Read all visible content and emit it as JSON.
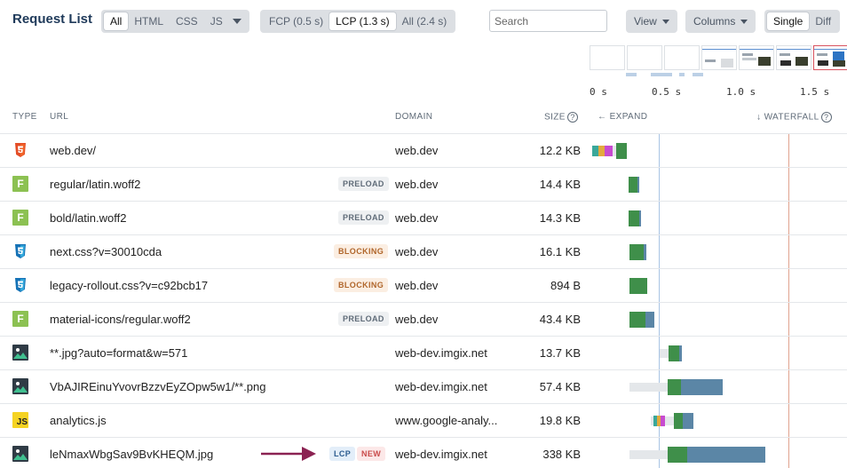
{
  "header": {
    "title": "Request List",
    "type_filters": [
      {
        "label": "All",
        "active": true
      },
      {
        "label": "HTML",
        "active": false
      },
      {
        "label": "CSS",
        "active": false
      },
      {
        "label": "JS",
        "active": false
      }
    ],
    "milestones": [
      {
        "label": "FCP (0.5 s)",
        "active": false
      },
      {
        "label": "LCP (1.3 s)",
        "active": true
      },
      {
        "label": "All (2.4 s)",
        "active": false
      }
    ],
    "search_placeholder": "Search",
    "view_label": "View",
    "columns_label": "Columns",
    "mode_options": [
      {
        "label": "Single",
        "active": true
      },
      {
        "label": "Diff",
        "active": false
      }
    ]
  },
  "timeline": {
    "ticks": [
      "0 s",
      "0.5 s",
      "1.0 s",
      "1.5 s"
    ]
  },
  "table": {
    "headers": {
      "type": "TYPE",
      "url": "URL",
      "domain": "DOMAIN",
      "size": "SIZE",
      "expand": "EXPAND",
      "waterfall": "WATERFALL"
    },
    "rows": [
      {
        "type": "html-icon",
        "url": "web.dev/",
        "badges": [],
        "domain": "web.dev",
        "size": "12.2 KB"
      },
      {
        "type": "font-icon",
        "url": "regular/latin.woff2",
        "badges": [
          "PRELOAD"
        ],
        "domain": "web.dev",
        "size": "14.4 KB"
      },
      {
        "type": "font-icon",
        "url": "bold/latin.woff2",
        "badges": [
          "PRELOAD"
        ],
        "domain": "web.dev",
        "size": "14.3 KB"
      },
      {
        "type": "css-icon",
        "url": "next.css?v=30010cda",
        "badges": [
          "BLOCKING"
        ],
        "domain": "web.dev",
        "size": "16.1 KB"
      },
      {
        "type": "css-icon",
        "url": "legacy-rollout.css?v=c92bcb17",
        "badges": [
          "BLOCKING"
        ],
        "domain": "web.dev",
        "size": "894 B"
      },
      {
        "type": "font-icon",
        "url": "material-icons/regular.woff2",
        "badges": [
          "PRELOAD"
        ],
        "domain": "web.dev",
        "size": "43.4 KB"
      },
      {
        "type": "image-icon",
        "url": "**.jpg?auto=format&w=571",
        "badges": [],
        "domain": "web-dev.imgix.net",
        "size": "13.7 KB"
      },
      {
        "type": "image-icon",
        "url": "VbAJIREinuYvovrBzzvEyZOpw5w1/**.png",
        "badges": [],
        "domain": "web-dev.imgix.net",
        "size": "57.4 KB"
      },
      {
        "type": "js-icon",
        "url": "analytics.js",
        "badges": [],
        "domain": "www.google-analy...",
        "size": "19.8 KB"
      },
      {
        "type": "image-icon",
        "url": "leNmaxWbgSav9BvKHEQM.jpg",
        "badges": [
          "LCP",
          "NEW"
        ],
        "domain": "web-dev.imgix.net",
        "size": "338 KB"
      }
    ]
  },
  "colors": {
    "html": "#e44d26",
    "css": "#2965f1",
    "font": "#8cc152",
    "js": "#f5d322",
    "download": "#3f8f4a",
    "content": "#5b86a6",
    "waiting": "#e4e7ea",
    "lcp_line": "#e0a38f",
    "fcp_line": "#a9c4e4",
    "arrow": "#8b2252"
  }
}
